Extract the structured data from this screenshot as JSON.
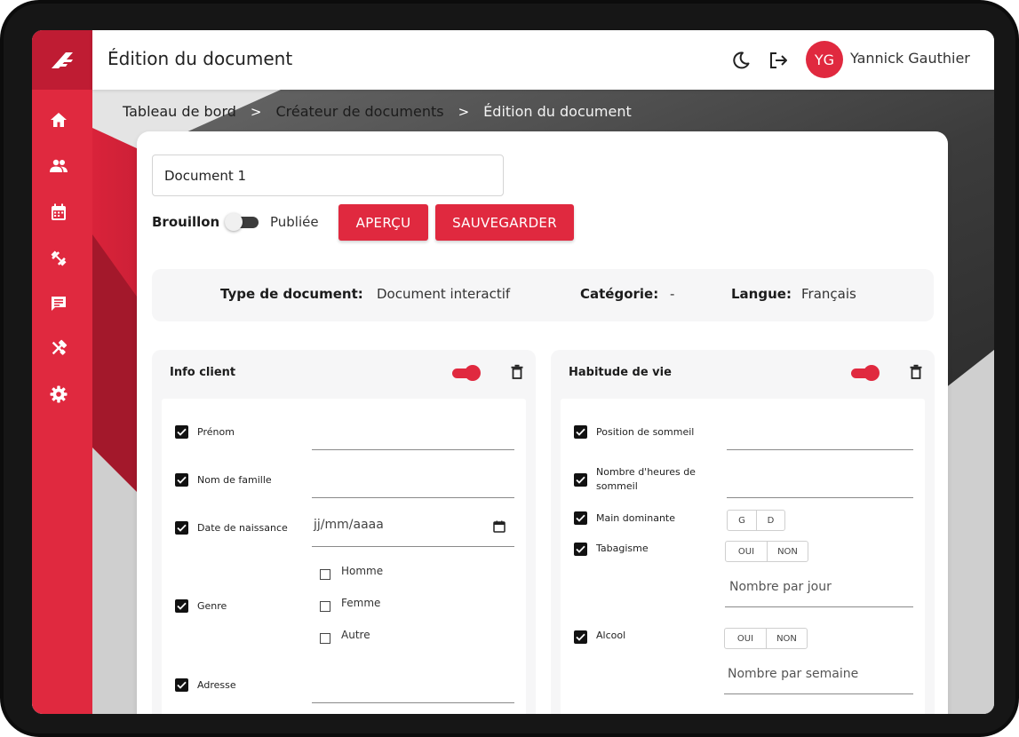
{
  "header": {
    "title": "Édition du document",
    "user_initials": "YG",
    "user_name": "Yannick Gauthier"
  },
  "sidebar": {
    "items": [
      {
        "name": "home",
        "icon": "home-icon"
      },
      {
        "name": "clients",
        "icon": "people-icon"
      },
      {
        "name": "calendar",
        "icon": "calendar-icon"
      },
      {
        "name": "training",
        "icon": "dumbbell-icon"
      },
      {
        "name": "messages",
        "icon": "chat-icon"
      },
      {
        "name": "tools",
        "icon": "tools-icon"
      },
      {
        "name": "settings",
        "icon": "gear-icon"
      }
    ]
  },
  "breadcrumb": {
    "items": [
      "Tableau de bord",
      "Créateur de documents",
      "Édition du document"
    ],
    "separator": ">"
  },
  "document": {
    "name": "Document 1",
    "status_draft": "Brouillon",
    "status_published": "Publiée",
    "preview_label": "APERÇU",
    "save_label": "SAUVEGARDER"
  },
  "info": {
    "type_label": "Type de document:",
    "type_value": "Document interactif",
    "category_label": "Catégorie:",
    "category_value": "-",
    "language_label": "Langue:",
    "language_value": "Français"
  },
  "sections": {
    "client": {
      "title": "Info client",
      "fields": {
        "first_name": "Prénom",
        "last_name": "Nom de famille",
        "birth_date": "Date de naissance",
        "birth_date_placeholder": "jj/mm/aaaa",
        "gender": "Genre",
        "gender_options": [
          "Homme",
          "Femme",
          "Autre"
        ],
        "address": "Adresse"
      }
    },
    "lifestyle": {
      "title": "Habitude de vie",
      "fields": {
        "sleep_position": "Position de sommeil",
        "sleep_hours_line1": "Nombre d'heures de",
        "sleep_hours_line2": "sommeil",
        "dominant_hand": "Main dominante",
        "hand_options": [
          "G",
          "D"
        ],
        "smoking": "Tabagisme",
        "yes": "OUI",
        "no": "NON",
        "per_day_placeholder": "Nombre par jour",
        "alcohol": "Alcool",
        "per_week_placeholder": "Nombre par semaine"
      }
    }
  },
  "colors": {
    "accent": "#e0293f",
    "accent_dark": "#bf1c33",
    "bg_dark": "#3a3a3a"
  }
}
